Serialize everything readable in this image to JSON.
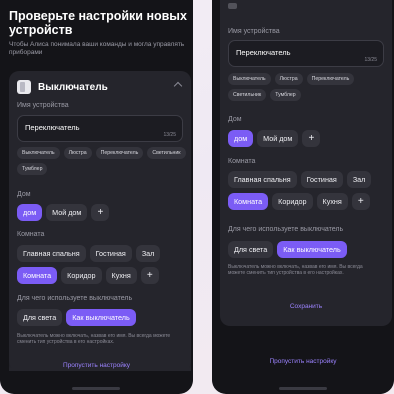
{
  "left": {
    "title": "Проверьте настройки новых устройств",
    "subtitle": "Чтобы Алиса понимала ваши команды и могла управлять приборами",
    "card_title": "Выключатель",
    "name_label": "Имя устройства",
    "name_value": "Переключатель",
    "name_count": "13/25",
    "suggestions": [
      "Выключатель",
      "Люстра",
      "Переключатель",
      "Светильник",
      "Тумблер"
    ],
    "home_label": "Дом",
    "homes": [
      "дом",
      "Мой дом",
      "+"
    ],
    "room_label": "Комната",
    "rooms": [
      "Главная спальня",
      "Гостиная",
      "Зал",
      "Комната",
      "Коридор",
      "Кухня",
      "+"
    ],
    "usage_label": "Для чего используете выключатель",
    "usages": [
      "Для света",
      "Как выключатель"
    ],
    "hint": "Выключатель можно включать, назвав его имя. Вы всегда можете сменить тип устройства в его настройках.",
    "skip": "Пропустить настройку"
  },
  "right": {
    "name_label": "Имя устройства",
    "name_value": "Переключатель",
    "name_count": "13/25",
    "suggestions": [
      "Выключатель",
      "Люстра",
      "Переключатель",
      "Светильник",
      "Тумблер"
    ],
    "home_label": "Дом",
    "homes": [
      "дом",
      "Мой дом",
      "+"
    ],
    "room_label": "Комната",
    "rooms": [
      "Главная спальня",
      "Гостиная",
      "Зал",
      "Комната",
      "Коридор",
      "Кухня",
      "+"
    ],
    "usage_label": "Для чего используете выключатель",
    "usages": [
      "Для света",
      "Как выключатель"
    ],
    "hint": "Выключатель можно включать, назвав его имя. Вы всегда можете сменить тип устройства в его настройках.",
    "save": "Сохранить",
    "skip": "Пропустить настройку"
  },
  "colors": {
    "accent": "#7b5cf5",
    "link": "#9c83ff",
    "bg": "#141418",
    "card": "#25252c"
  }
}
